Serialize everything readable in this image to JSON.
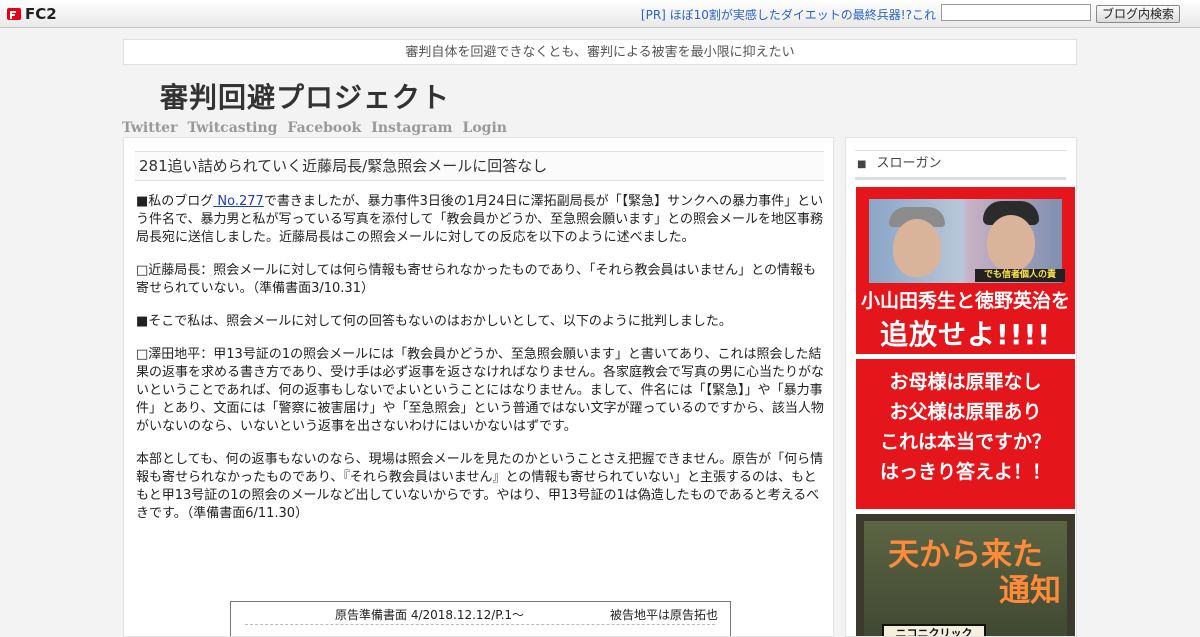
{
  "fc2": {
    "logo": "FC2",
    "pr_link": "[PR] ほぼ10割が実感したダイエットの最終兵器!?これ",
    "search_value": "",
    "search_button": "ブログ内検索"
  },
  "blog": {
    "tagline": "審判自体を回避できなくとも、審判による被害を最小限に抑えたい",
    "title": "審判回避プロジェクト",
    "nav": [
      "Twitter",
      "Twitcasting",
      "Facebook",
      "Instagram",
      "Login"
    ]
  },
  "post": {
    "title": "281追い詰められていく近藤局長/緊急照会メールに回答なし",
    "p1_pre": "■私のブログ",
    "p1_link": " No.277",
    "p1_post": "で書きましたが、暴力事件3日後の1月24日に澤拓副局長が「【緊急】サンクへの暴力事件」という件名で、暴力男と私が写っている写真を添付して「教会員かどうか、至急照会願います」との照会メールを地区事務局長宛に送信しました。近藤局長はこの照会メールに対しての反応を以下のように述べました。",
    "p2": "□近藤局長：照会メールに対しては何ら情報も寄せられなかったものであり、「それら教会員はいません」との情報も寄せられていない。（準備書面3/10.31）",
    "p3": "■そこで私は、照会メールに対して何の回答もないのはおかしいとして、以下のように批判しました。",
    "p4": "□澤田地平：甲13号証の1の照会メールには「教会員かどうか、至急照会願います」と書いてあり、これは照会した結果の返事を求める書き方であり、受け手は必ず返事を返さなければなりません。各家庭教会で写真の男に心当たりがないということであれば、何の返事もしないでよいということにはなりません。まして、件名には「【緊急】」や「暴力事件」とあり、文面には「警察に被害届け」や「至急照会」という普通ではない文字が躍っているのですから、該当人物がいないのなら、いないという返事を出さないわけにはいかないはずです。",
    "p5": "本部としても、何の返事もないのなら、現場は照会メールを見たのかということさえ把握できません。原告が「何ら情報も寄せられなかったものであり、『それら教会員はいません』との情報も寄せられていない」と主張するのは、もともと甲13号証の1の照会のメールなど出していないからです。やはり、甲13号証の1は偽造したものであると考えるべきです。（準備書面6/11.30）",
    "doc_header": "原告準備書面 4/2018.12.12/P.1～",
    "doc_right": "被告地平は原告拓也"
  },
  "sidebar": {
    "heading_mark": "■",
    "heading": "スローガン",
    "banner1_tag": "でも信者個人の責",
    "banner1_line1": "小山田秀生と徳野英治を",
    "banner1_line2": "追放せよ!!!!",
    "banner2_lines": [
      "お母様は原罪なし",
      "お父様は原罪あり",
      "これは本当ですか？",
      "はっきり答えよ！！"
    ],
    "banner3_line1": "天から来た",
    "banner3_line2": "通知",
    "banner3_box": "ニコニクリック"
  }
}
